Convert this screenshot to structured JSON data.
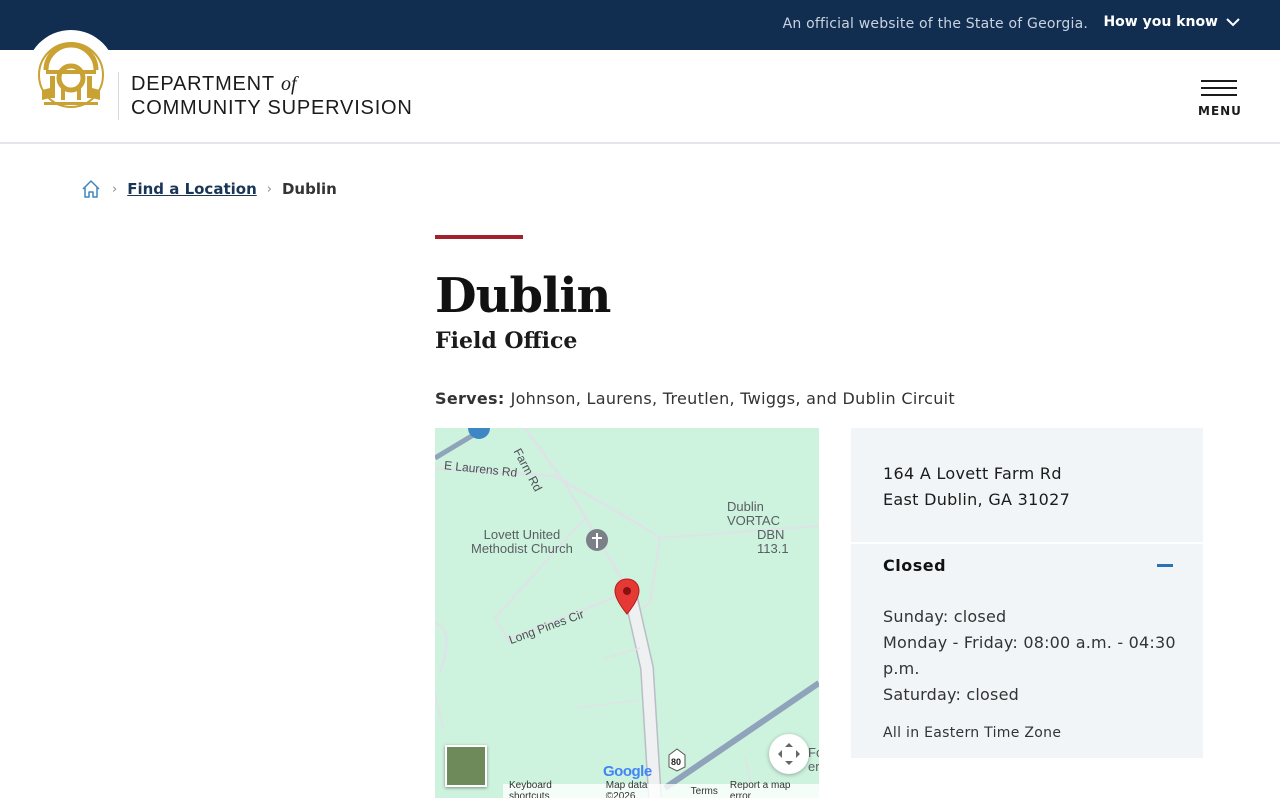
{
  "banner": {
    "official_text": "An official website of the State of Georgia.",
    "how_you_know": "How you know"
  },
  "header": {
    "brand_line1": "DEPARTMENT",
    "brand_of": "of",
    "brand_line2": "COMMUNITY SUPERVISION",
    "menu_label": "MENU"
  },
  "breadcrumb": {
    "items": [
      "Find a Location",
      "Dublin"
    ]
  },
  "page": {
    "title": "Dublin",
    "subtitle": "Field Office",
    "serves_label": "Serves:",
    "serves_value": "Johnson, Laurens, Treutlen, Twiggs, and Dublin Circuit"
  },
  "map": {
    "labels": {
      "farm_rd": "Farm Rd",
      "e_laurens_rd": "E Laurens Rd",
      "long_pines_cir": "Long Pines Cir",
      "church_line1": "Lovett United",
      "church_line2": "Methodist Church",
      "vortac_line1": "Dublin VORTAC",
      "vortac_line2": "DBN 113.1",
      "fo_line1": "Fo",
      "fo_line2": "er",
      "route_80": "80"
    },
    "google_logo": "Google",
    "footer": [
      "Keyboard shortcuts",
      "Map data ©2026",
      "Terms",
      "Report a map error"
    ]
  },
  "location": {
    "address_line1": "164 A Lovett Farm Rd",
    "address_line2": "East Dublin, GA 31027",
    "status": "Closed",
    "hours": [
      "Sunday: closed",
      "Monday - Friday: 08:00 a.m. - 04:30 p.m.",
      "Saturday: closed"
    ],
    "timezone_note": "All in Eastern Time Zone"
  },
  "colors": {
    "banner_bg": "#112e51",
    "accent_red": "#a3212a",
    "info_bg": "#f2f5f8",
    "link_blue": "#1b3556",
    "map_green": "#cdf2dd",
    "seal_gold": "#c9a233"
  }
}
